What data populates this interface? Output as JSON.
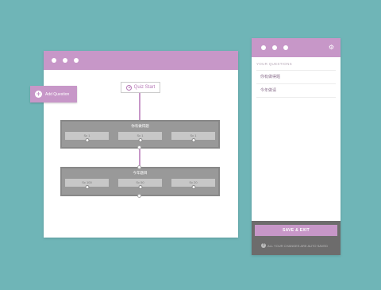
{
  "add_question": {
    "label": "Add Question",
    "icon": "plus-circle-icon"
  },
  "quiz_start": {
    "label": "Quiz Start",
    "icon": "play-circle-icon"
  },
  "questions_canvas": [
    {
      "title": "你有做得题",
      "answers": [
        "Sc 1",
        "Sc 1",
        "Sc 1"
      ]
    },
    {
      "title": "今年题目",
      "answers": [
        "Sc 100",
        "Sc 50",
        "Sc 20"
      ]
    }
  ],
  "panel": {
    "heading": "YOUR QUESTIONS",
    "items": [
      "你有做得题",
      "今年做请"
    ],
    "save_label": "SAVE & EXIT",
    "autosave_text": "ALL YOUR CHANGES ARE AUTO SAVED"
  },
  "colors": {
    "accent": "#c797c8",
    "background": "#6fb5b7",
    "footer": "#6d6c6c",
    "node": "#999999"
  }
}
